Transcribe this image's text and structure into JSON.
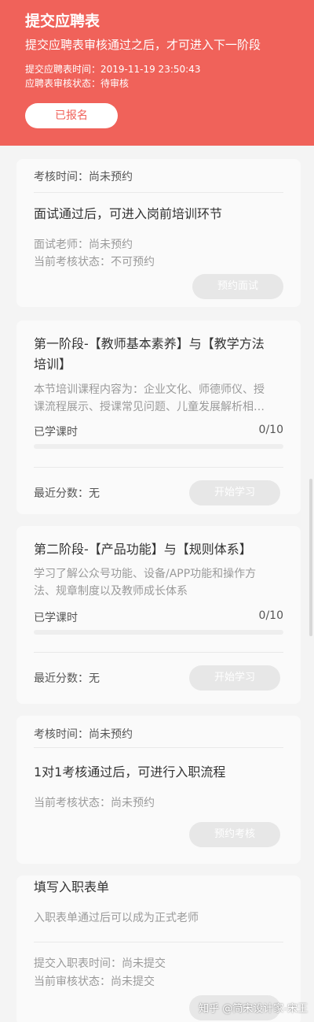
{
  "header": {
    "title": "提交应聘表",
    "subtitle": "提交应聘表审核通过之后，才可进入下一阶段",
    "submit_time": "提交应聘表时间：2019-11-19 23:50:43",
    "review_status": "应聘表审核状态：待审核",
    "signup_badge": "已报名"
  },
  "interview": {
    "exam_time": "考核时间：尚未预约",
    "heading": "面试通过后，可进入岗前培训环节",
    "teacher": "面试老师：尚未预约",
    "status": "当前考核状态：不可预约",
    "button": "预约面试"
  },
  "stage1": {
    "title_line1": "第一阶段-【教师基本素养】与【教学方法",
    "title_line2": "培训】",
    "desc_line1": "本节培训课程内容为：企业文化、师德师仪、授",
    "desc_line2": "课流程展示、授课常见问题、儿童发展解析相…",
    "hours_label": "已学课时",
    "hours_value": "0/10",
    "progress": 0,
    "score": "最近分数：无",
    "button": "开始学习"
  },
  "stage2": {
    "title": "第二阶段-【产品功能】与【规则体系】",
    "desc_line1": "学习了解公众号功能、设备/APP功能和操作方",
    "desc_line2": "法、规章制度以及教师成长体系",
    "hours_label": "已学课时",
    "hours_value": "0/10",
    "progress": 0,
    "score": "最近分数：无",
    "button": "开始学习"
  },
  "assessment": {
    "exam_time": "考核时间：尚未预约",
    "heading": "1对1考核通过后，可进行入职流程",
    "status": "当前考核状态：尚未预约",
    "button": "预约考核"
  },
  "onboarding": {
    "title": "填写入职表单",
    "desc": "入职表单通过后可以成为正式老师",
    "submit_time": "提交入职表时间：尚未提交",
    "review_status": "当前审核状态：尚未提交"
  },
  "watermark": "知乎 @简宋设计家-宋王",
  "colors": {
    "accent": "#f0625a",
    "card": "#fafafa",
    "background": "#f4f4f4",
    "disabled_button": "#e7e7e7"
  }
}
